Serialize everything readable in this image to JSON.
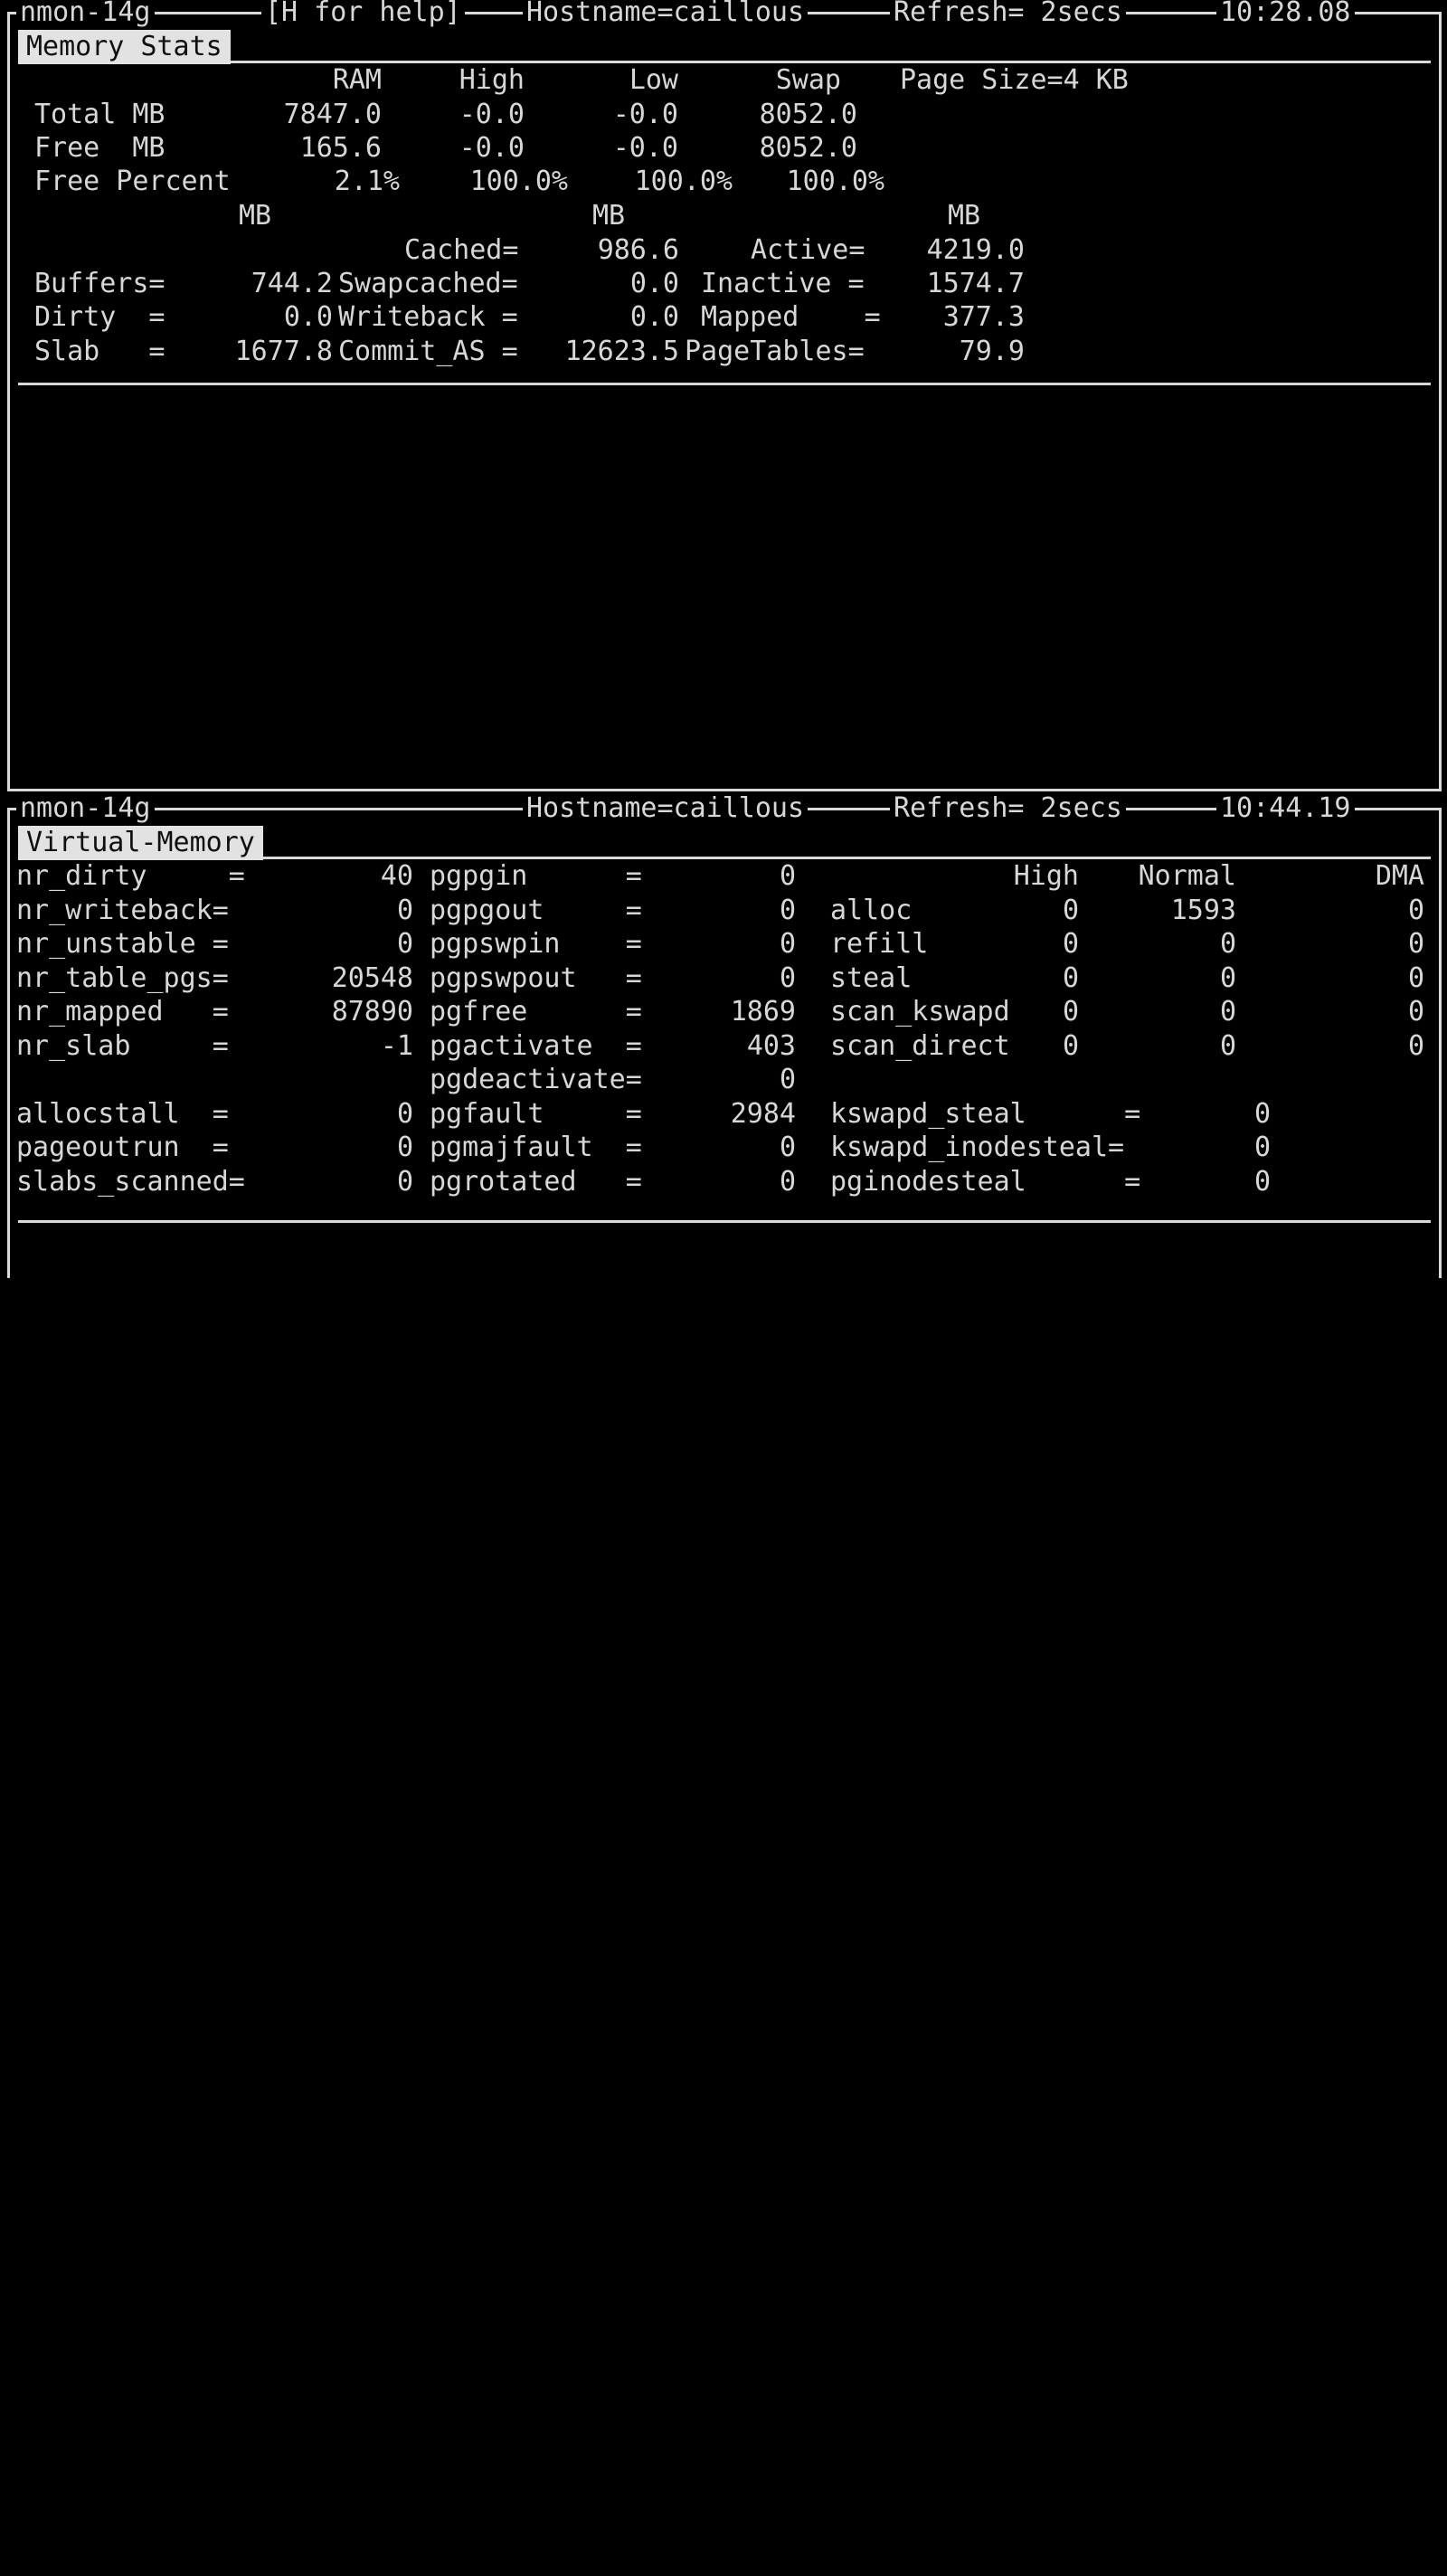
{
  "app": {
    "name": "nmon-14g",
    "help_hint": "[H for help]"
  },
  "panels": [
    {
      "id": "memory-stats",
      "title": "Memory Stats",
      "header": {
        "app": "nmon-14g",
        "help_hint": "[H for help]",
        "hostname": "Hostname=caillous",
        "refresh": "Refresh= 2secs",
        "clock": "10:28.08"
      },
      "columns": [
        "RAM",
        "High",
        "Low",
        "Swap"
      ],
      "page_size": "Page Size=4 KB",
      "rows": [
        {
          "label": "Total MB",
          "ram": "7847.0",
          "high": "-0.0",
          "low": "-0.0",
          "swap": "8052.0"
        },
        {
          "label": "Free  MB",
          "ram": "165.6",
          "high": "-0.0",
          "low": "-0.0",
          "swap": "8052.0"
        },
        {
          "label": "Free Percent",
          "ram": "2.1%",
          "high": "100.0%",
          "low": "100.0%",
          "swap": "100.0%"
        }
      ],
      "unit_row": {
        "u1": "MB",
        "u2": "MB",
        "u3": "MB"
      },
      "detail_rows": [
        {
          "l1": "",
          "v1": "",
          "l2": "Cached=",
          "v2": "986.6",
          "l3": "Active=",
          "v3": "4219.0"
        },
        {
          "l1": "Buffers=",
          "v1": "744.2",
          "l2": "Swapcached=",
          "v2": "0.0",
          "l3": "Inactive =",
          "v3": "1574.7"
        },
        {
          "l1": "Dirty  =",
          "v1": "0.0",
          "l2": "Writeback =",
          "v2": "0.0",
          "l3": "Mapped    =",
          "v3": "377.3"
        },
        {
          "l1": "Slab   =",
          "v1": "1677.8",
          "l2": "Commit_AS =",
          "v2": "12623.5",
          "l3": "PageTables=",
          "v3": "79.9"
        }
      ]
    },
    {
      "id": "virtual-memory",
      "title": "Virtual-Memory",
      "header": {
        "app": "nmon-14g",
        "hostname": "Hostname=caillous",
        "refresh": "Refresh= 2secs",
        "clock": "10:44.19"
      },
      "col_a": [
        {
          "label": "nr_dirty     =",
          "value": "40"
        },
        {
          "label": "nr_writeback=",
          "value": "0"
        },
        {
          "label": "nr_unstable =",
          "value": "0"
        },
        {
          "label": "nr_table_pgs=",
          "value": "20548"
        },
        {
          "label": "nr_mapped   =",
          "value": "87890"
        },
        {
          "label": "nr_slab     =",
          "value": "-1"
        },
        {
          "label": "",
          "value": ""
        },
        {
          "label": "allocstall  =",
          "value": "0"
        },
        {
          "label": "pageoutrun  =",
          "value": "0"
        },
        {
          "label": "slabs_scanned=",
          "value": "0"
        }
      ],
      "col_b": [
        {
          "label": "pgpgin      =",
          "value": "0"
        },
        {
          "label": "pgpgout     =",
          "value": "0"
        },
        {
          "label": "pgpswpin    =",
          "value": "0"
        },
        {
          "label": "pgpswpout   =",
          "value": "0"
        },
        {
          "label": "pgfree      =",
          "value": "1869"
        },
        {
          "label": "pgactivate  =",
          "value": "403"
        },
        {
          "label": "pgdeactivate=",
          "value": "0"
        },
        {
          "label": "pgfault     =",
          "value": "2984"
        },
        {
          "label": "pgmajfault  =",
          "value": "0"
        },
        {
          "label": "pgrotated   =",
          "value": "0"
        }
      ],
      "zone_headers": [
        "High",
        "Normal",
        "DMA"
      ],
      "zone_rows": [
        {
          "label": "alloc",
          "high": "0",
          "normal": "1593",
          "dma": "0"
        },
        {
          "label": "refill",
          "high": "0",
          "normal": "0",
          "dma": "0"
        },
        {
          "label": "steal",
          "high": "0",
          "normal": "0",
          "dma": "0"
        },
        {
          "label": "scan_kswapd",
          "high": "0",
          "normal": "0",
          "dma": "0"
        },
        {
          "label": "scan_direct",
          "high": "0",
          "normal": "0",
          "dma": "0"
        }
      ],
      "kswapd_rows": [
        {
          "label": "kswapd_steal      =",
          "value": "0"
        },
        {
          "label": "kswapd_inodesteal=",
          "value": "0"
        },
        {
          "label": "pginodesteal      =",
          "value": "0"
        }
      ]
    }
  ],
  "colors": {
    "background": "#000000",
    "foreground": "#d7d7d7",
    "rule": "#d9d9d9",
    "tag_background": "#e2e2e2",
    "tag_foreground": "#101010"
  }
}
